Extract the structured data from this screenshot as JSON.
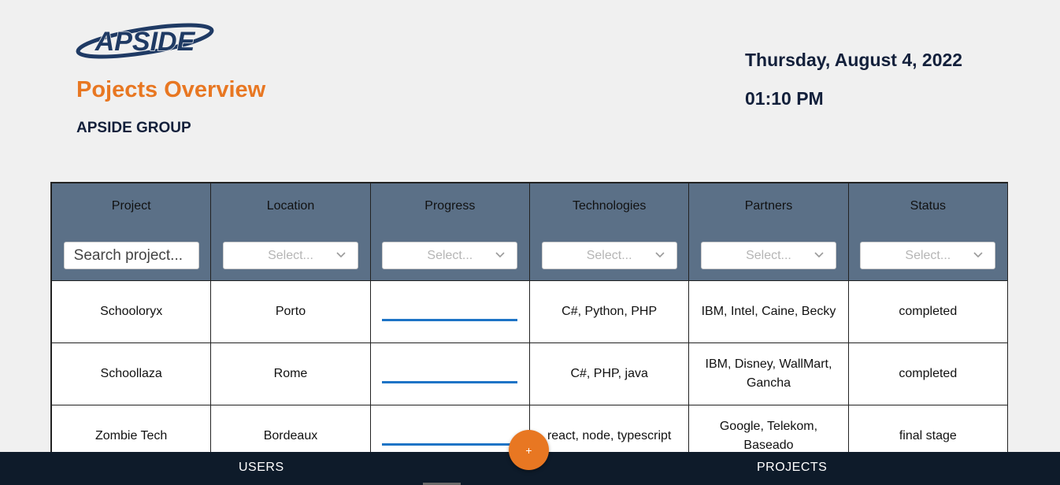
{
  "header": {
    "logo_text": "APSIDE",
    "title": "Pojects Overview",
    "company": "APSIDE GROUP",
    "date": "Thursday, August 4, 2022",
    "time": "01:10 PM"
  },
  "table": {
    "columns": [
      {
        "label": "Project",
        "filter_type": "search",
        "filter_value": "Search project..."
      },
      {
        "label": "Location",
        "filter_type": "select",
        "filter_value": "Select..."
      },
      {
        "label": "Progress",
        "filter_type": "select",
        "filter_value": "Select..."
      },
      {
        "label": "Technologies",
        "filter_type": "select",
        "filter_value": "Select..."
      },
      {
        "label": "Partners",
        "filter_type": "select",
        "filter_value": "Select..."
      },
      {
        "label": "Status",
        "filter_type": "select",
        "filter_value": "Select..."
      }
    ],
    "rows": [
      {
        "project": "Schooloryx",
        "location": "Porto",
        "progress": 1.0,
        "technologies": "C#, Python, PHP",
        "partners": "IBM, Intel, Caine, Becky",
        "status": "completed"
      },
      {
        "project": "Schoollaza",
        "location": "Rome",
        "progress": 1.0,
        "technologies": "C#, PHP, java",
        "partners": "IBM, Disney, WallMart, Gancha",
        "status": "completed"
      },
      {
        "project": "Zombie Tech",
        "location": "Bordeaux",
        "progress": 1.0,
        "technologies": "react, node, typescript",
        "partners": "Google, Telekom, Baseado",
        "status": "final stage"
      }
    ]
  },
  "fab": {
    "label": "+"
  },
  "nav": {
    "users": "USERS",
    "projects": "PROJECTS"
  },
  "colors": {
    "accent": "#e87722",
    "header_bg": "#5b7087",
    "navy": "#13203b",
    "progress": "#1e74c6",
    "bottom_bar": "#0e1b2a"
  }
}
